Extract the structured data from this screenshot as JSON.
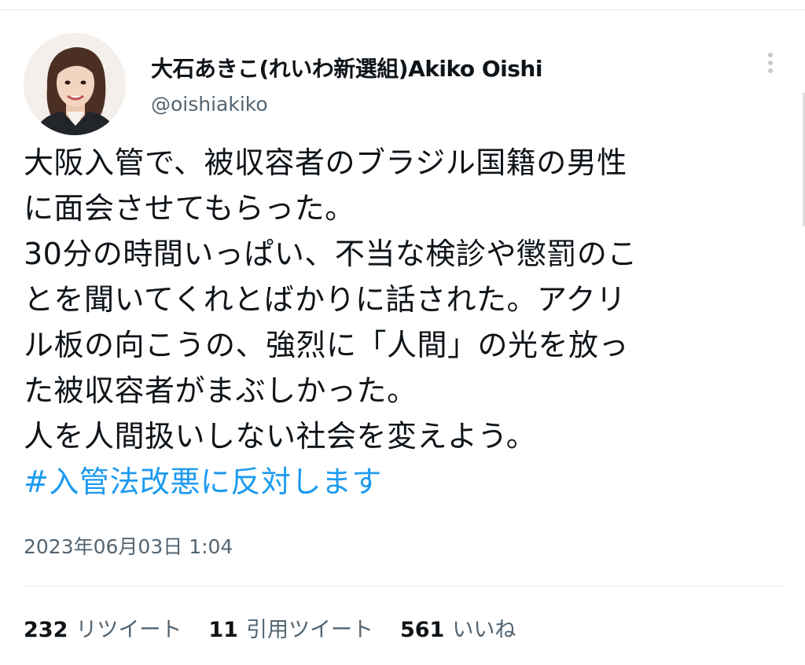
{
  "author": {
    "display_name": "大石あきこ(れいわ新選組)Akiko Oishi",
    "handle": "@oishiakiko"
  },
  "tweet": {
    "lines": [
      "大阪入管で、被収容者のブラジル国籍の男性",
      "に面会させてもらった。",
      "30分の時間いっぱい、不当な検診や懲罰のこ",
      "とを聞いてくれとばかりに話された。アクリ",
      "ル板の向こうの、強烈に「人間」の光を放っ",
      "た被収容者がまぶしかった。",
      "人を人間扱いしない社会を変えよう。"
    ],
    "hashtag": "#入管法改悪に反対します",
    "timestamp": "2023年06月03日 1:04"
  },
  "stats": {
    "retweets": {
      "count": "232",
      "label": "リツイート"
    },
    "quotes": {
      "count": "11",
      "label": "引用ツイート"
    },
    "likes": {
      "count": "561",
      "label": "いいね"
    }
  },
  "colors": {
    "hashtag": "#1d9bf0",
    "secondary_text": "#536471",
    "primary_text": "#0f1419"
  },
  "icons": {
    "more": "more-vertical-icon"
  }
}
